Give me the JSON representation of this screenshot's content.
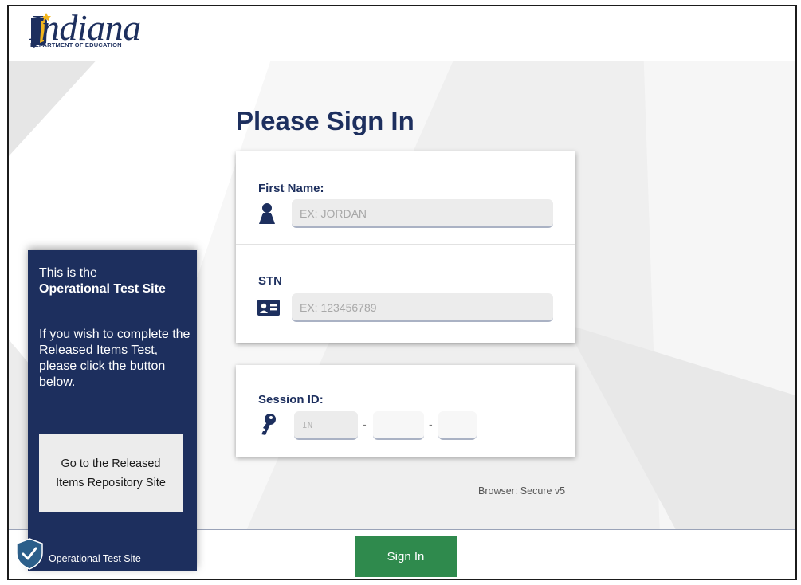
{
  "header": {
    "logo_word": "Indiana",
    "logo_sub": "DEPARTMENT OF EDUCATION"
  },
  "title": "Please Sign In",
  "form": {
    "first_name": {
      "label": "First Name:",
      "placeholder": "EX: JORDAN",
      "value": "",
      "icon": "person-icon"
    },
    "stn": {
      "label": "STN",
      "placeholder": "EX: 123456789",
      "value": "",
      "icon": "id-card-icon"
    },
    "session": {
      "label": "Session ID:",
      "icon": "key-icon",
      "prefix_placeholder": "IN",
      "part2": "",
      "part3": "",
      "separator": "-"
    }
  },
  "panel": {
    "intro": "This is the",
    "site_name": "Operational Test Site",
    "instructions": "If you wish to complete the Released Items Test, please click the button below.",
    "button_label": "Go to the Released Items Repository Site"
  },
  "footer": {
    "site_label": "Operational Test Site",
    "browser": "Browser: Secure v5",
    "signin_label": "Sign In"
  },
  "colors": {
    "navy": "#1d2f5e",
    "green": "#2f8a4d",
    "input_bg": "#ececec",
    "shield": "#2c5f8a"
  }
}
